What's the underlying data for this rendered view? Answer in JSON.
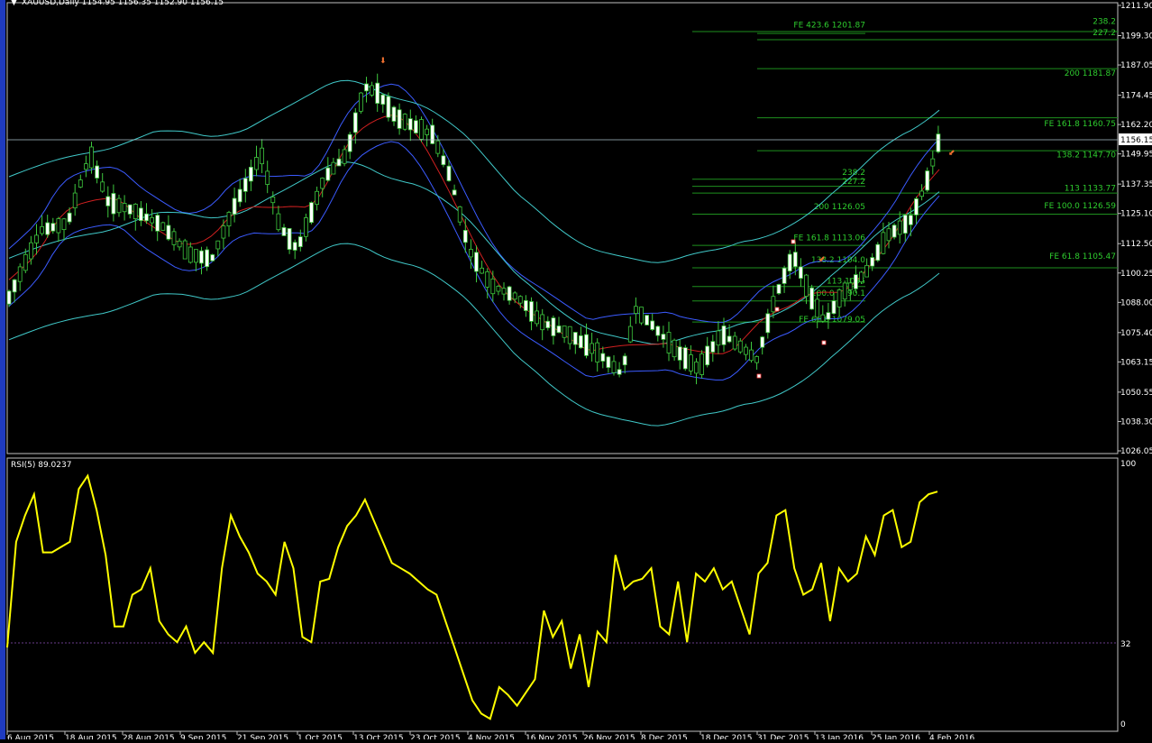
{
  "header": {
    "symbol_line": "XAUUSD,Daily  1154.95 1156.35 1152.90 1156.15",
    "current_price": "1156.15"
  },
  "rsi": {
    "label": "RSI(5) 89.0237",
    "levels": [
      "100",
      "32",
      "0"
    ]
  },
  "price_axis": [
    "1211.90",
    "1199.30",
    "1187.05",
    "1174.45",
    "1162.20",
    "1149.95",
    "1137.35",
    "1125.10",
    "1112.50",
    "1100.25",
    "1088.00",
    "1075.40",
    "1063.15",
    "1050.55",
    "1038.30",
    "1026.05"
  ],
  "date_axis": [
    "6 Aug 2015",
    "18 Aug 2015",
    "28 Aug 2015",
    "9 Sep 2015",
    "21 Sep 2015",
    "1 Oct 2015",
    "13 Oct 2015",
    "23 Oct 2015",
    "4 Nov 2015",
    "16 Nov 2015",
    "26 Nov 2015",
    "8 Dec 2015",
    "18 Dec 2015",
    "31 Dec 2015",
    "13 Jan 2016",
    "25 Jan 2016",
    "4 Feb 2016"
  ],
  "fib_labels": [
    {
      "text": "FE 423.6 1201.87",
      "price": 1201.87,
      "side": "mid"
    },
    {
      "text": "238.2",
      "price": 1203.5,
      "side": "right"
    },
    {
      "text": "227.2",
      "price": 1198.8,
      "side": "right"
    },
    {
      "text": "200 1181.87",
      "price": 1181.87,
      "side": "right"
    },
    {
      "text": "FE 161.8 1160.75",
      "price": 1160.75,
      "side": "right"
    },
    {
      "text": "138.2 1147.70",
      "price": 1147.7,
      "side": "right"
    },
    {
      "text": "238.2",
      "price": 1140.5,
      "side": "mid2"
    },
    {
      "text": "227.2",
      "price": 1136.7,
      "side": "mid2"
    },
    {
      "text": "113 1133.77",
      "price": 1133.77,
      "side": "right"
    },
    {
      "text": "200 1126.05",
      "price": 1126.05,
      "side": "mid2"
    },
    {
      "text": "FE 100.0 1126.59",
      "price": 1126.59,
      "side": "right"
    },
    {
      "text": "FE 161.8 1113.06",
      "price": 1113.06,
      "side": "mid3"
    },
    {
      "text": "138.2 1104.0",
      "price": 1104.0,
      "side": "mid3"
    },
    {
      "text": "FE 61.8 1105.47",
      "price": 1105.47,
      "side": "right"
    },
    {
      "text": "113 1095",
      "price": 1095.0,
      "side": "mid4"
    },
    {
      "text": "100.0 1090.1",
      "price": 1090.1,
      "side": "mid4"
    },
    {
      "text": "FE 61.8 1079.05",
      "price": 1079.05,
      "side": "mid3"
    }
  ],
  "chart_data": {
    "type": "candlestick",
    "title": "XAUUSD,Daily",
    "ylim": [
      1026.05,
      1211.9
    ],
    "x": [
      "2015-08-06",
      "2015-08-18",
      "2015-08-28",
      "2015-09-09",
      "2015-09-21",
      "2015-10-01",
      "2015-10-13",
      "2015-10-23",
      "2015-11-04",
      "2015-11-16",
      "2015-11-26",
      "2015-12-08",
      "2015-12-18",
      "2015-12-31",
      "2016-01-13",
      "2016-01-25",
      "2016-02-04"
    ],
    "close_approx": [
      1088.0,
      1118.0,
      1133.0,
      1118.0,
      1131.0,
      1114.0,
      1158.0,
      1165.0,
      1108.0,
      1082.0,
      1066.0,
      1076.0,
      1068.0,
      1061.0,
      1090.0,
      1118.0,
      1156.15
    ],
    "last_bar": {
      "open": 1154.95,
      "high": 1156.35,
      "low": 1152.9,
      "close": 1156.15
    },
    "rsi": {
      "name": "RSI(5)",
      "last": 89.0237,
      "ylim": [
        0,
        100
      ],
      "level": 32
    }
  }
}
